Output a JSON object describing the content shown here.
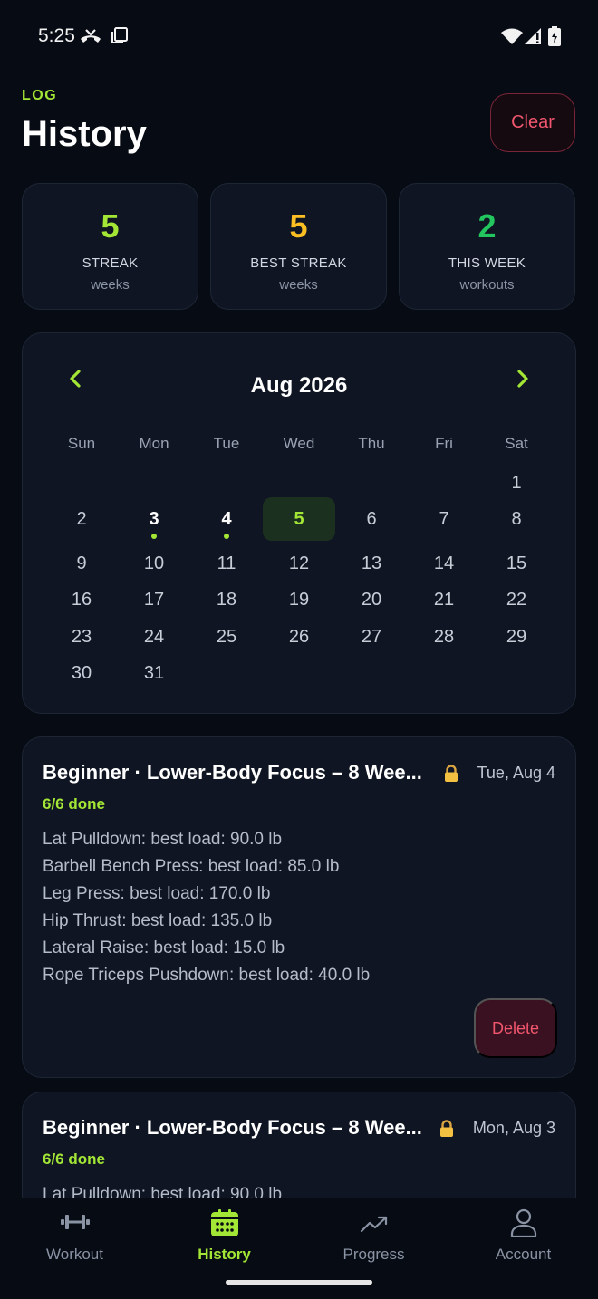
{
  "status_bar": {
    "time": "5:25"
  },
  "header": {
    "eyebrow": "LOG",
    "title": "History",
    "clear_label": "Clear"
  },
  "stats": [
    {
      "value": "5",
      "label": "STREAK",
      "sub": "weeks",
      "color": "#a3e635"
    },
    {
      "value": "5",
      "label": "BEST STREAK",
      "sub": "weeks",
      "color": "#fbbf24"
    },
    {
      "value": "2",
      "label": "THIS WEEK",
      "sub": "workouts",
      "color": "#22c55e"
    }
  ],
  "calendar": {
    "month_label": "Aug 2026",
    "weekdays": [
      "Sun",
      "Mon",
      "Tue",
      "Wed",
      "Thu",
      "Fri",
      "Sat"
    ],
    "days": [
      {
        "n": "1",
        "logged": false,
        "today": false
      },
      {
        "n": "2",
        "logged": false,
        "today": false
      },
      {
        "n": "3",
        "logged": true,
        "today": false
      },
      {
        "n": "4",
        "logged": true,
        "today": false
      },
      {
        "n": "5",
        "logged": false,
        "today": true
      },
      {
        "n": "6",
        "logged": false,
        "today": false
      },
      {
        "n": "7",
        "logged": false,
        "today": false
      },
      {
        "n": "8",
        "logged": false,
        "today": false
      },
      {
        "n": "9",
        "logged": false,
        "today": false
      },
      {
        "n": "10",
        "logged": false,
        "today": false
      },
      {
        "n": "11",
        "logged": false,
        "today": false
      },
      {
        "n": "12",
        "logged": false,
        "today": false
      },
      {
        "n": "13",
        "logged": false,
        "today": false
      },
      {
        "n": "14",
        "logged": false,
        "today": false
      },
      {
        "n": "15",
        "logged": false,
        "today": false
      },
      {
        "n": "16",
        "logged": false,
        "today": false
      },
      {
        "n": "17",
        "logged": false,
        "today": false
      },
      {
        "n": "18",
        "logged": false,
        "today": false
      },
      {
        "n": "19",
        "logged": false,
        "today": false
      },
      {
        "n": "20",
        "logged": false,
        "today": false
      },
      {
        "n": "21",
        "logged": false,
        "today": false
      },
      {
        "n": "22",
        "logged": false,
        "today": false
      },
      {
        "n": "23",
        "logged": false,
        "today": false
      },
      {
        "n": "24",
        "logged": false,
        "today": false
      },
      {
        "n": "25",
        "logged": false,
        "today": false
      },
      {
        "n": "26",
        "logged": false,
        "today": false
      },
      {
        "n": "27",
        "logged": false,
        "today": false
      },
      {
        "n": "28",
        "logged": false,
        "today": false
      },
      {
        "n": "29",
        "logged": false,
        "today": false
      },
      {
        "n": "30",
        "logged": false,
        "today": false
      },
      {
        "n": "31",
        "logged": false,
        "today": false
      }
    ]
  },
  "sessions": [
    {
      "title": "Beginner · Lower-Body Focus – 8 Wee...",
      "date": "Tue, Aug 4",
      "done": "6/6 done",
      "exercises": [
        "Lat Pulldown: best load: 90.0 lb",
        "Barbell Bench Press: best load: 85.0 lb",
        "Leg Press: best load: 170.0 lb",
        "Hip Thrust: best load: 135.0 lb",
        "Lateral Raise: best load: 15.0 lb",
        "Rope Triceps Pushdown: best load: 40.0 lb"
      ],
      "delete_label": "Delete"
    },
    {
      "title": "Beginner · Lower-Body Focus – 8 Wee...",
      "date": "Mon, Aug 3",
      "done": "6/6 done",
      "exercises": [
        "Lat Pulldown: best load: 90.0 lb"
      ]
    }
  ],
  "bottom_nav": {
    "items": [
      {
        "label": "Workout",
        "icon": "dumbbell-icon",
        "active": false
      },
      {
        "label": "History",
        "icon": "calendar-icon",
        "active": true
      },
      {
        "label": "Progress",
        "icon": "trend-up-icon",
        "active": false
      },
      {
        "label": "Account",
        "icon": "person-icon",
        "active": false
      }
    ]
  },
  "colors": {
    "accent": "#a3e635",
    "danger": "#f0566e",
    "card": "#0f1522",
    "background": "#070b14"
  }
}
